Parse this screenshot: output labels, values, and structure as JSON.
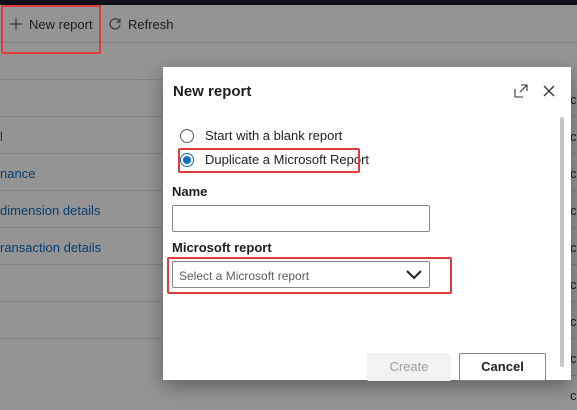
{
  "toolbar": {
    "new_report_label": "New report",
    "refresh_label": "Refresh"
  },
  "background_list": {
    "rows": [
      "",
      "",
      "l",
      "nance",
      "dimension details",
      "ransaction details",
      "",
      ""
    ],
    "right_chars": [
      "c",
      "c",
      "c",
      "c",
      "c",
      "c",
      "c",
      "c",
      "c"
    ]
  },
  "dialog": {
    "title": "New report",
    "options": {
      "blank_label": "Start with a blank report",
      "duplicate_label": "Duplicate a Microsoft Report",
      "selected": "duplicate"
    },
    "name_label": "Name",
    "name_value": "",
    "ms_report_label": "Microsoft report",
    "ms_report_placeholder": "Select a Microsoft report",
    "create_label": "Create",
    "cancel_label": "Cancel"
  },
  "icons": {
    "new": "plus-icon",
    "refresh": "refresh-icon",
    "expand": "expand-icon",
    "close": "close-icon",
    "dropdown": "chevron-down-icon"
  },
  "colors": {
    "accent": "#0f6cbd",
    "highlight": "#e03a3a",
    "link": "#0f6cbd"
  }
}
